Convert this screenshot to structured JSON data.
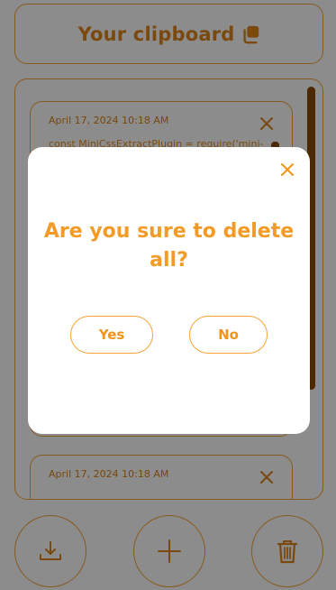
{
  "header": {
    "title": "Your clipboard",
    "icon": "copy-icon"
  },
  "clips": [
    {
      "timestamp": "April 17, 2024 10:18 AM",
      "text": "const MiniCssExtractPlugin = require('mini-"
    },
    {
      "timestamp": "April 17, 2024 10:18 AM",
      "text": ""
    }
  ],
  "actions": {
    "download_icon": "download-icon",
    "add_icon": "plus-icon",
    "delete_icon": "trash-icon"
  },
  "dialog": {
    "message": "Are you sure to delete all?",
    "yes_label": "Yes",
    "no_label": "No"
  },
  "colors": {
    "accent": "#f0941b",
    "border": "#f5a43a",
    "scrollbar": "#8a4a06",
    "overlay": "rgba(0,0,0,0.45)"
  }
}
